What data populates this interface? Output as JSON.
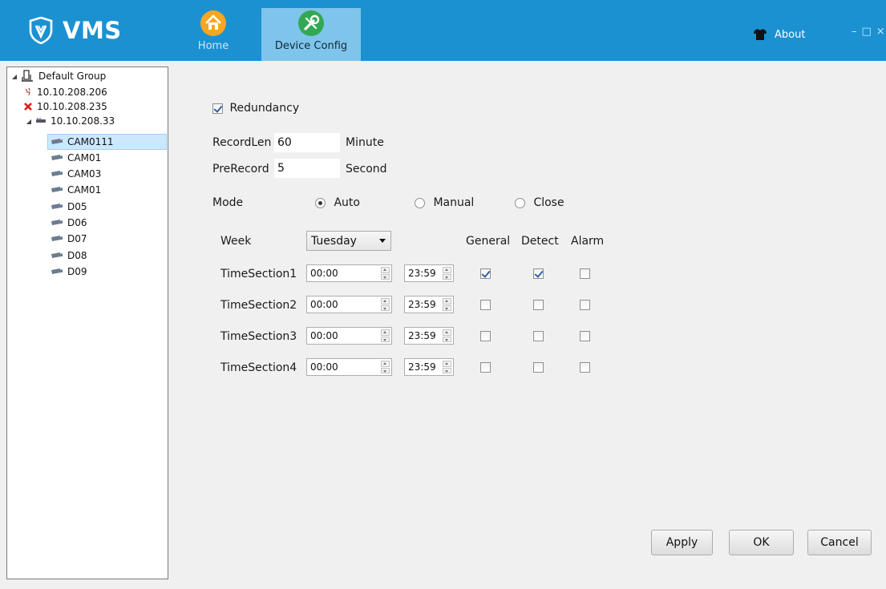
{
  "app": {
    "title": "VMS"
  },
  "nav": {
    "tabs": [
      {
        "label": "Home",
        "icon": "home-icon",
        "active": false
      },
      {
        "label": "Device Config",
        "icon": "wrench-icon",
        "active": true
      }
    ],
    "about_label": "About",
    "window_controls": [
      "–",
      "□",
      "×"
    ]
  },
  "tree": {
    "root": "Default Group",
    "devices": [
      {
        "label": "10.10.208.206",
        "icon": "plug-icon"
      },
      {
        "label": "10.10.208.235",
        "icon": "error-x-icon"
      },
      {
        "label": "10.10.208.33",
        "icon": "device-icon"
      }
    ],
    "channels": [
      "CAM0111",
      "CAM01",
      "CAM03",
      "CAM01",
      "D05",
      "D06",
      "D07",
      "D08",
      "D09"
    ],
    "selected_channel": "CAM0111"
  },
  "config": {
    "redundancy_label": "Redundancy",
    "redundancy_checked": true,
    "record_len_label": "RecordLen",
    "record_len_value": "60",
    "record_len_unit": "Minute",
    "pre_record_label": "PreRecord",
    "pre_record_value": "5",
    "pre_record_unit": "Second",
    "mode_label": "Mode",
    "mode_options": [
      "Auto",
      "Manual",
      "Close"
    ],
    "mode_selected": "Auto",
    "week_label": "Week",
    "week_value": "Tuesday",
    "col_general": "General",
    "col_detect": "Detect",
    "col_alarm": "Alarm",
    "sections": [
      {
        "label": "TimeSection1",
        "start": "00:00",
        "end": "23:59",
        "general": true,
        "detect": true,
        "alarm": false
      },
      {
        "label": "TimeSection2",
        "start": "00:00",
        "end": "23:59",
        "general": false,
        "detect": false,
        "alarm": false
      },
      {
        "label": "TimeSection3",
        "start": "00:00",
        "end": "23:59",
        "general": false,
        "detect": false,
        "alarm": false
      },
      {
        "label": "TimeSection4",
        "start": "00:00",
        "end": "23:59",
        "general": false,
        "detect": false,
        "alarm": false
      }
    ]
  },
  "buttons": {
    "apply": "Apply",
    "ok": "OK",
    "cancel": "Cancel"
  },
  "colors": {
    "header": "#1b91d2",
    "active_tab": "#7fc4ea",
    "panel_bg": "#f0f0f0"
  }
}
